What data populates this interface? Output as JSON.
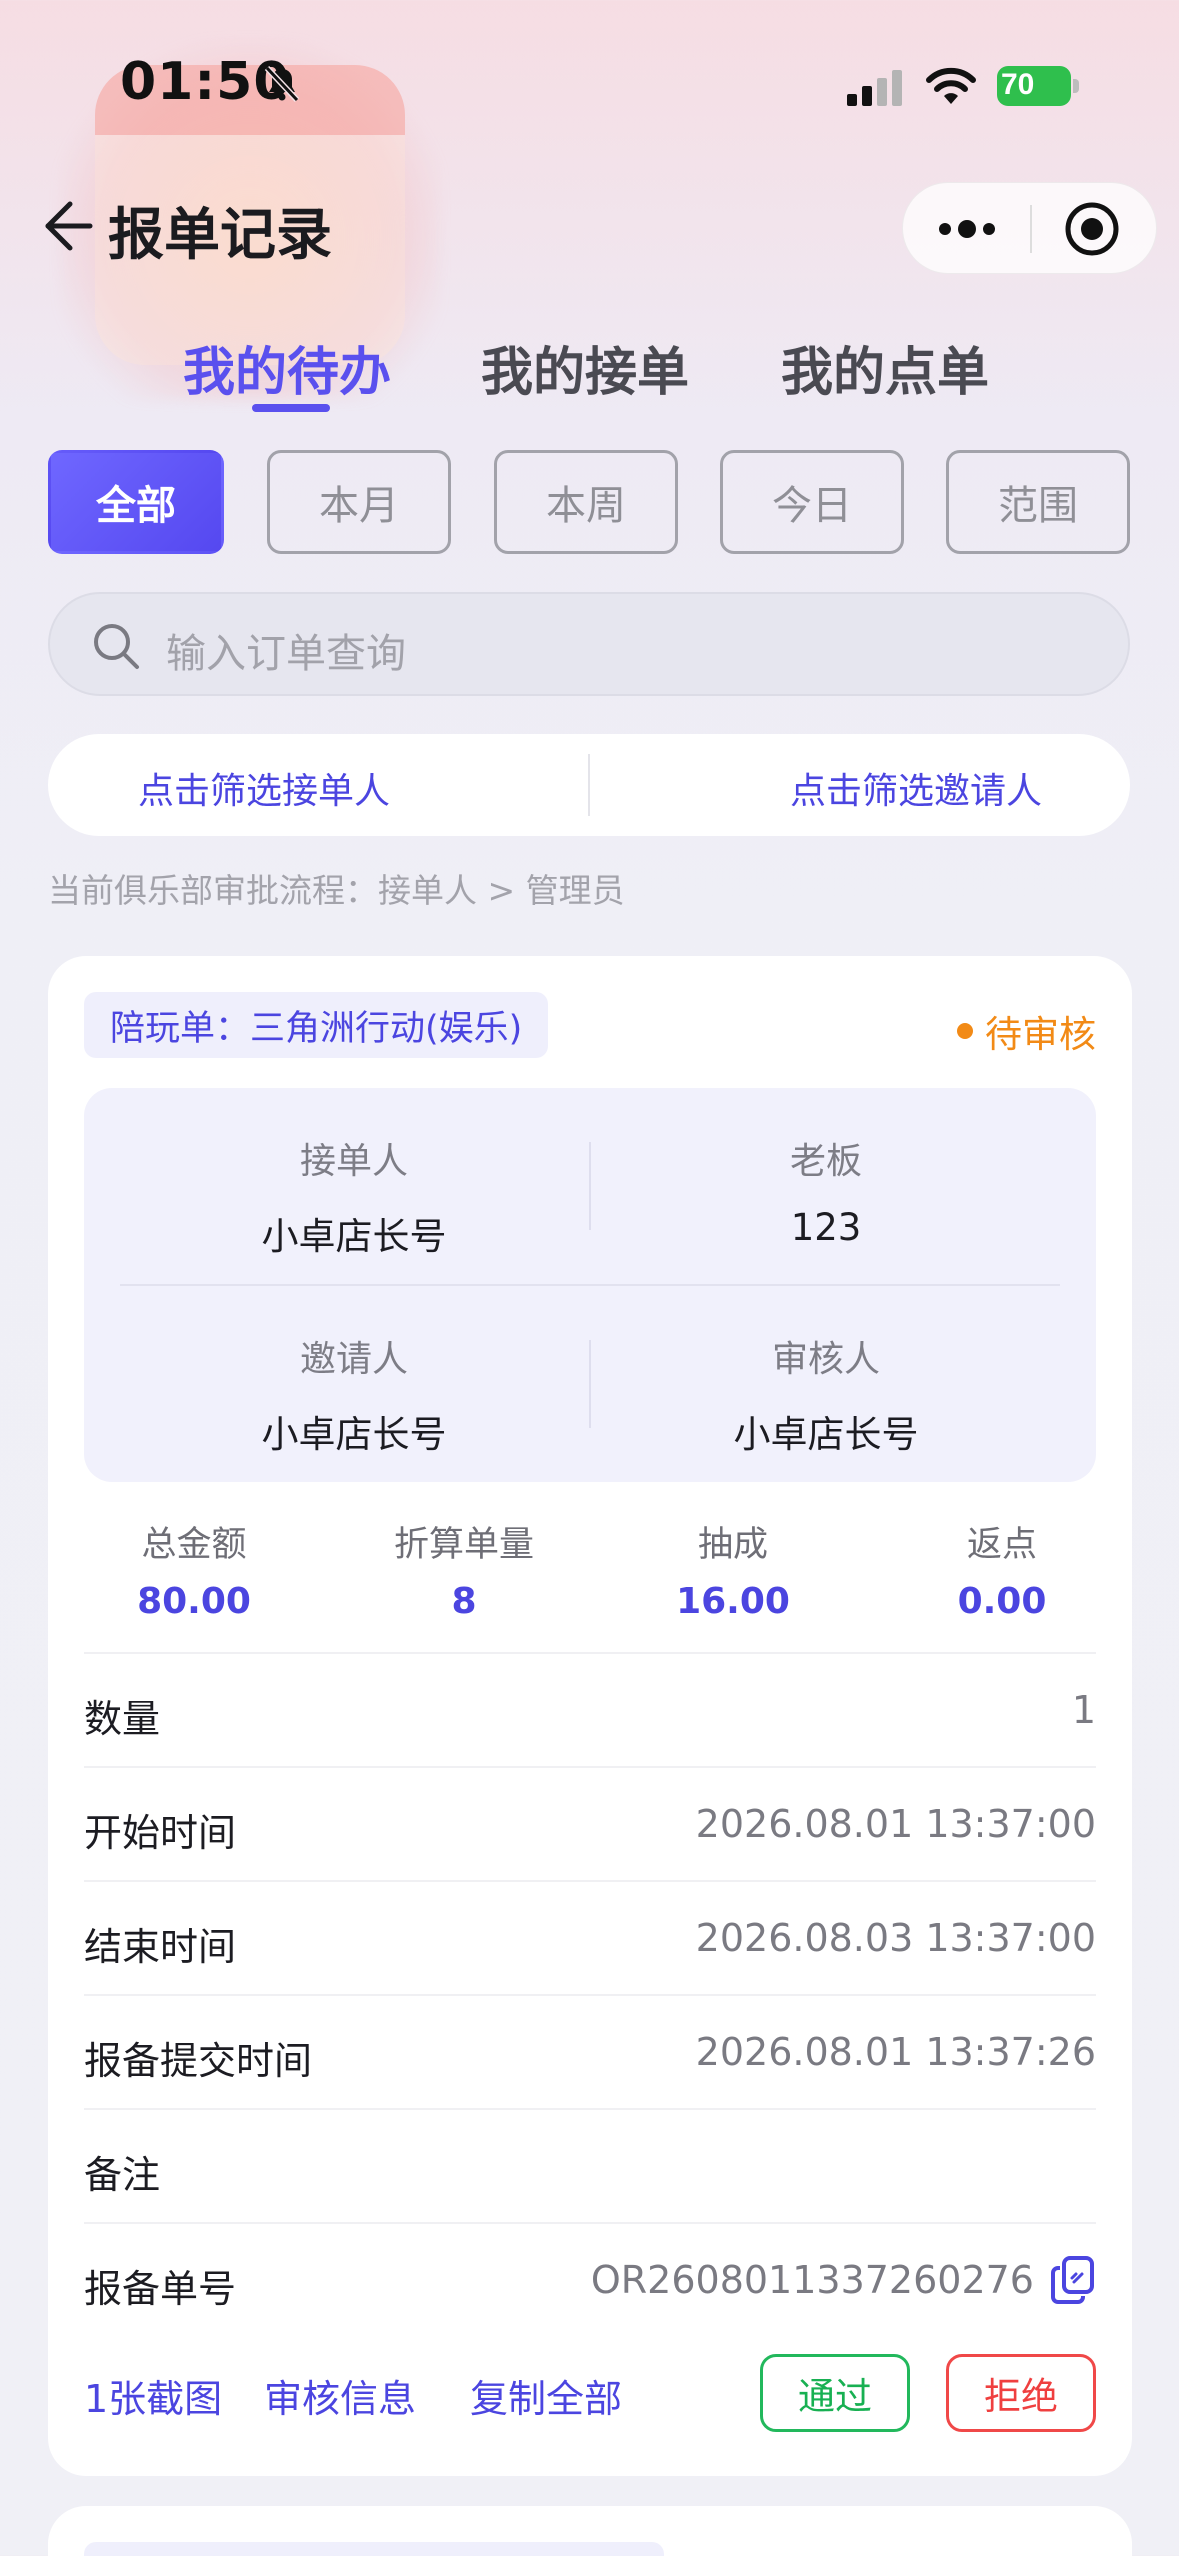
{
  "status_bar": {
    "time": "01:50",
    "battery": "70"
  },
  "nav": {
    "title": "报单记录"
  },
  "tabs": [
    {
      "label": "我的待办",
      "active": true
    },
    {
      "label": "我的接单",
      "active": false
    },
    {
      "label": "我的点单",
      "active": false
    }
  ],
  "filters": [
    "全部",
    "本月",
    "本周",
    "今日",
    "范围"
  ],
  "search": {
    "placeholder": "输入订单查询"
  },
  "picker": {
    "taker": "点击筛选接单人",
    "inviter": "点击筛选邀请人"
  },
  "flow_text": "当前俱乐部审批流程：接单人 > 管理员",
  "order": {
    "type_tag": "陪玩单：三角洲行动(娱乐)",
    "status": "待审核",
    "people": {
      "taker_label": "接单人",
      "taker": "小卓店长号",
      "boss_label": "老板",
      "boss": "123",
      "inviter_label": "邀请人",
      "inviter": "小卓店长号",
      "reviewer_label": "审核人",
      "reviewer": "小卓店长号"
    },
    "stats": {
      "total_label": "总金额",
      "total": "80.00",
      "units_label": "折算单量",
      "units": "8",
      "commission_label": "抽成",
      "commission": "16.00",
      "rebate_label": "返点",
      "rebate": "0.00"
    },
    "rows": {
      "qty_label": "数量",
      "qty": "1",
      "start_label": "开始时间",
      "start": "2026.08.01 13:37:00",
      "end_label": "结束时间",
      "end": "2026.08.03 13:37:00",
      "submit_label": "报备提交时间",
      "submit": "2026.08.01 13:37:26",
      "note_label": "备注",
      "note": "",
      "no_label": "报备单号",
      "no": "OR2608011337260276"
    },
    "actions": {
      "screenshots": "1张截图",
      "review_info": "审核信息",
      "copy_all": "复制全部",
      "approve": "通过",
      "reject": "拒绝"
    }
  },
  "colors": {
    "accent": "#5a50ee",
    "pending": "#f28a16",
    "approve": "#22b85c",
    "reject": "#f04848"
  }
}
